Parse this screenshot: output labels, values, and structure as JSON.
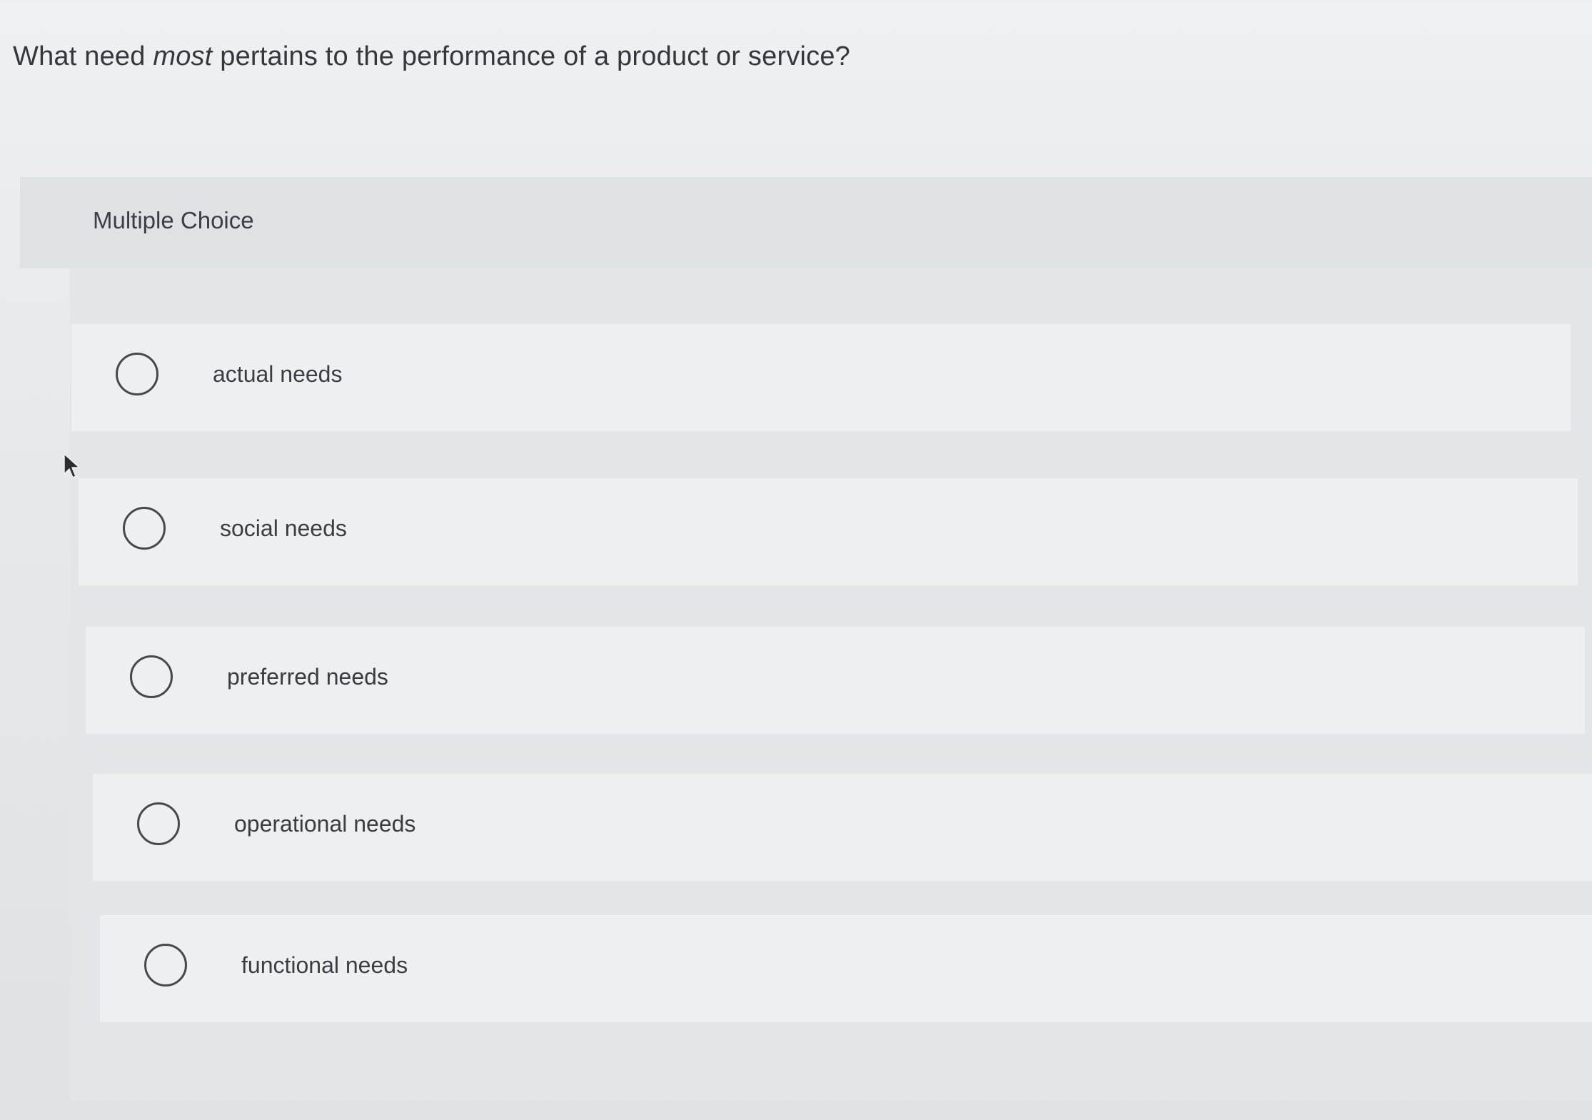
{
  "question": {
    "prefix": "What need ",
    "emphasis": "most",
    "suffix": " pertains to the performance of a product or service?"
  },
  "question_type_label": "Multiple Choice",
  "options": [
    {
      "label": "actual needs",
      "selected": false
    },
    {
      "label": "social needs",
      "selected": false
    },
    {
      "label": "preferred needs",
      "selected": false
    },
    {
      "label": "operational needs",
      "selected": false
    },
    {
      "label": "functional needs",
      "selected": false
    }
  ],
  "icons": {
    "cursor": "mouse-pointer-icon",
    "radio": "radio-empty-icon"
  }
}
